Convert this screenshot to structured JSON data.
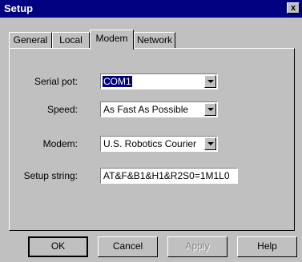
{
  "window": {
    "title": "Setup",
    "close_label": "x"
  },
  "tabs": [
    {
      "label": "General",
      "active": false
    },
    {
      "label": "Local",
      "active": false
    },
    {
      "label": "Modem",
      "active": true
    },
    {
      "label": "Network",
      "active": false
    }
  ],
  "fields": {
    "serial_port": {
      "label": "Serial pot:",
      "value": "COM1"
    },
    "speed": {
      "label": "Speed:",
      "value": "As Fast As Possible"
    },
    "modem": {
      "label": "Modem:",
      "value": "U.S. Robotics Courier"
    },
    "setup_string": {
      "label": "Setup string:",
      "value": "AT&F&B1&H1&R2S0=1M1L0"
    }
  },
  "buttons": {
    "ok": "OK",
    "cancel": "Cancel",
    "apply": "Apply",
    "help": "Help"
  }
}
